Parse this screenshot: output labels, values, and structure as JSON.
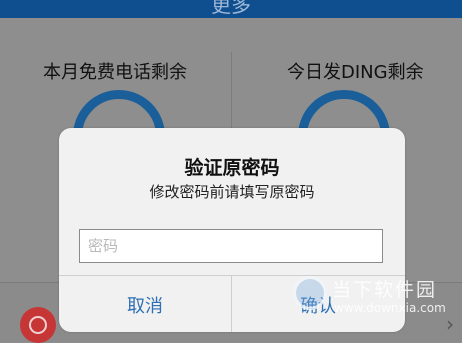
{
  "nav": {
    "title": "更多"
  },
  "stats": {
    "left_label": "本月免费电话剩余",
    "right_label": "今日发DING剩余",
    "ring_color": "#1a5f99"
  },
  "dialog": {
    "title": "验证原密码",
    "subtitle": "修改密码前请填写原密码",
    "password_placeholder": "密码",
    "password_value": "",
    "cancel_label": "取消",
    "confirm_label": "确认",
    "button_color": "#2f6fb5"
  },
  "list": {
    "chevron": "›"
  },
  "watermark": {
    "text": "当下软件园",
    "url": "www.downxia.com"
  }
}
